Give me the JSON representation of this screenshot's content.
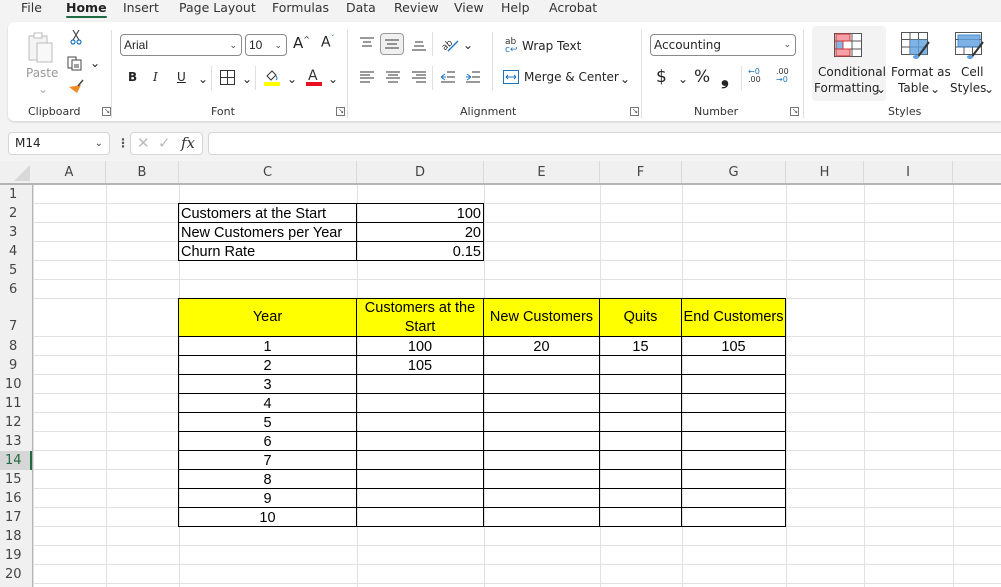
{
  "menu": {
    "tabs": [
      "File",
      "Home",
      "Insert",
      "Page Layout",
      "Formulas",
      "Data",
      "Review",
      "View",
      "Help",
      "Acrobat"
    ],
    "active": "Home"
  },
  "ribbon": {
    "clipboard": {
      "label": "Clipboard",
      "paste": "Paste"
    },
    "font": {
      "label": "Font",
      "font_name": "Arial",
      "font_size": "10",
      "bold": "B",
      "italic": "I",
      "underline": "U",
      "fill_color": "#ffff00",
      "font_color": "#e81123"
    },
    "alignment": {
      "label": "Alignment",
      "wrap_text": "Wrap Text",
      "merge_center": "Merge & Center"
    },
    "number": {
      "label": "Number",
      "format": "Accounting",
      "currency": "$",
      "percent": "%",
      "comma": "❟",
      "inc_decimal_top": "←0",
      "inc_decimal_bottom": ".00",
      "dec_decimal_top": ".00",
      "dec_decimal_bottom": "→0"
    },
    "styles": {
      "label": "Styles",
      "conditional_1": "Conditional",
      "conditional_2": "Formatting",
      "format_table_1": "Format as",
      "format_table_2": "Table",
      "cell_styles_1": "Cell",
      "cell_styles_2": "Styles"
    }
  },
  "formula_bar": {
    "name_box": "M14",
    "fx": "fx",
    "formula": ""
  },
  "columns": [
    "A",
    "B",
    "C",
    "D",
    "E",
    "F",
    "G",
    "H",
    "I"
  ],
  "rows": [
    "1",
    "2",
    "3",
    "4",
    "5",
    "6",
    "7",
    "8",
    "9",
    "10",
    "11",
    "12",
    "13",
    "14",
    "15",
    "16",
    "17",
    "18",
    "19",
    "20"
  ],
  "selected_row": "14",
  "inputs": [
    {
      "label": "Customers at the Start",
      "value": "100"
    },
    {
      "label": "New Customers per Year",
      "value": "20"
    },
    {
      "label": "Churn Rate",
      "value": "0.15"
    }
  ],
  "table": {
    "headers": [
      "Year",
      "Customers at the Start",
      "New Customers",
      "Quits",
      "End Customers"
    ],
    "header_fill": "#ffff00",
    "rows": [
      [
        "1",
        "100",
        "20",
        "15",
        "105"
      ],
      [
        "2",
        "105",
        "",
        "",
        ""
      ],
      [
        "3",
        "",
        "",
        "",
        ""
      ],
      [
        "4",
        "",
        "",
        "",
        ""
      ],
      [
        "5",
        "",
        "",
        "",
        ""
      ],
      [
        "6",
        "",
        "",
        "",
        ""
      ],
      [
        "7",
        "",
        "",
        "",
        ""
      ],
      [
        "8",
        "",
        "",
        "",
        ""
      ],
      [
        "9",
        "",
        "",
        "",
        ""
      ],
      [
        "10",
        "",
        "",
        "",
        ""
      ]
    ]
  }
}
